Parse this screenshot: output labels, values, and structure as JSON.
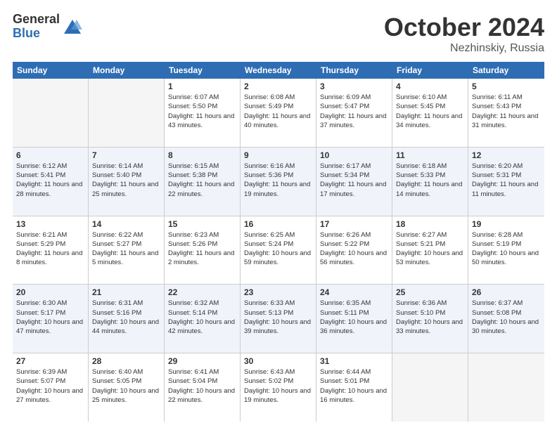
{
  "header": {
    "logo": {
      "general": "General",
      "blue": "Blue"
    },
    "title": "October 2024",
    "location": "Nezhinskiy, Russia"
  },
  "weekdays": [
    "Sunday",
    "Monday",
    "Tuesday",
    "Wednesday",
    "Thursday",
    "Friday",
    "Saturday"
  ],
  "weeks": [
    [
      {
        "day": "",
        "info": "",
        "empty": true
      },
      {
        "day": "",
        "info": "",
        "empty": true
      },
      {
        "day": "1",
        "info": "Sunrise: 6:07 AM\nSunset: 5:50 PM\nDaylight: 11 hours and 43 minutes.",
        "empty": false
      },
      {
        "day": "2",
        "info": "Sunrise: 6:08 AM\nSunset: 5:49 PM\nDaylight: 11 hours and 40 minutes.",
        "empty": false
      },
      {
        "day": "3",
        "info": "Sunrise: 6:09 AM\nSunset: 5:47 PM\nDaylight: 11 hours and 37 minutes.",
        "empty": false
      },
      {
        "day": "4",
        "info": "Sunrise: 6:10 AM\nSunset: 5:45 PM\nDaylight: 11 hours and 34 minutes.",
        "empty": false
      },
      {
        "day": "5",
        "info": "Sunrise: 6:11 AM\nSunset: 5:43 PM\nDaylight: 11 hours and 31 minutes.",
        "empty": false
      }
    ],
    [
      {
        "day": "6",
        "info": "Sunrise: 6:12 AM\nSunset: 5:41 PM\nDaylight: 11 hours and 28 minutes.",
        "empty": false
      },
      {
        "day": "7",
        "info": "Sunrise: 6:14 AM\nSunset: 5:40 PM\nDaylight: 11 hours and 25 minutes.",
        "empty": false
      },
      {
        "day": "8",
        "info": "Sunrise: 6:15 AM\nSunset: 5:38 PM\nDaylight: 11 hours and 22 minutes.",
        "empty": false
      },
      {
        "day": "9",
        "info": "Sunrise: 6:16 AM\nSunset: 5:36 PM\nDaylight: 11 hours and 19 minutes.",
        "empty": false
      },
      {
        "day": "10",
        "info": "Sunrise: 6:17 AM\nSunset: 5:34 PM\nDaylight: 11 hours and 17 minutes.",
        "empty": false
      },
      {
        "day": "11",
        "info": "Sunrise: 6:18 AM\nSunset: 5:33 PM\nDaylight: 11 hours and 14 minutes.",
        "empty": false
      },
      {
        "day": "12",
        "info": "Sunrise: 6:20 AM\nSunset: 5:31 PM\nDaylight: 11 hours and 11 minutes.",
        "empty": false
      }
    ],
    [
      {
        "day": "13",
        "info": "Sunrise: 6:21 AM\nSunset: 5:29 PM\nDaylight: 11 hours and 8 minutes.",
        "empty": false
      },
      {
        "day": "14",
        "info": "Sunrise: 6:22 AM\nSunset: 5:27 PM\nDaylight: 11 hours and 5 minutes.",
        "empty": false
      },
      {
        "day": "15",
        "info": "Sunrise: 6:23 AM\nSunset: 5:26 PM\nDaylight: 11 hours and 2 minutes.",
        "empty": false
      },
      {
        "day": "16",
        "info": "Sunrise: 6:25 AM\nSunset: 5:24 PM\nDaylight: 10 hours and 59 minutes.",
        "empty": false
      },
      {
        "day": "17",
        "info": "Sunrise: 6:26 AM\nSunset: 5:22 PM\nDaylight: 10 hours and 56 minutes.",
        "empty": false
      },
      {
        "day": "18",
        "info": "Sunrise: 6:27 AM\nSunset: 5:21 PM\nDaylight: 10 hours and 53 minutes.",
        "empty": false
      },
      {
        "day": "19",
        "info": "Sunrise: 6:28 AM\nSunset: 5:19 PM\nDaylight: 10 hours and 50 minutes.",
        "empty": false
      }
    ],
    [
      {
        "day": "20",
        "info": "Sunrise: 6:30 AM\nSunset: 5:17 PM\nDaylight: 10 hours and 47 minutes.",
        "empty": false
      },
      {
        "day": "21",
        "info": "Sunrise: 6:31 AM\nSunset: 5:16 PM\nDaylight: 10 hours and 44 minutes.",
        "empty": false
      },
      {
        "day": "22",
        "info": "Sunrise: 6:32 AM\nSunset: 5:14 PM\nDaylight: 10 hours and 42 minutes.",
        "empty": false
      },
      {
        "day": "23",
        "info": "Sunrise: 6:33 AM\nSunset: 5:13 PM\nDaylight: 10 hours and 39 minutes.",
        "empty": false
      },
      {
        "day": "24",
        "info": "Sunrise: 6:35 AM\nSunset: 5:11 PM\nDaylight: 10 hours and 36 minutes.",
        "empty": false
      },
      {
        "day": "25",
        "info": "Sunrise: 6:36 AM\nSunset: 5:10 PM\nDaylight: 10 hours and 33 minutes.",
        "empty": false
      },
      {
        "day": "26",
        "info": "Sunrise: 6:37 AM\nSunset: 5:08 PM\nDaylight: 10 hours and 30 minutes.",
        "empty": false
      }
    ],
    [
      {
        "day": "27",
        "info": "Sunrise: 6:39 AM\nSunset: 5:07 PM\nDaylight: 10 hours and 27 minutes.",
        "empty": false
      },
      {
        "day": "28",
        "info": "Sunrise: 6:40 AM\nSunset: 5:05 PM\nDaylight: 10 hours and 25 minutes.",
        "empty": false
      },
      {
        "day": "29",
        "info": "Sunrise: 6:41 AM\nSunset: 5:04 PM\nDaylight: 10 hours and 22 minutes.",
        "empty": false
      },
      {
        "day": "30",
        "info": "Sunrise: 6:43 AM\nSunset: 5:02 PM\nDaylight: 10 hours and 19 minutes.",
        "empty": false
      },
      {
        "day": "31",
        "info": "Sunrise: 6:44 AM\nSunset: 5:01 PM\nDaylight: 10 hours and 16 minutes.",
        "empty": false
      },
      {
        "day": "",
        "info": "",
        "empty": true
      },
      {
        "day": "",
        "info": "",
        "empty": true
      }
    ]
  ]
}
